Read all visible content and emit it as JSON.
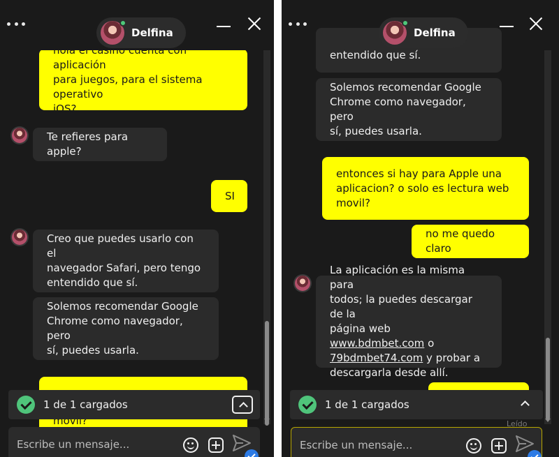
{
  "agent": {
    "name": "Delfina"
  },
  "left": {
    "messages": [
      {
        "from": "user",
        "text": "hola el casino cuenta con aplicación\npara juegos, para el sistema operativo\niOS?"
      },
      {
        "from": "agent",
        "text": "Te refieres para apple?"
      },
      {
        "from": "user",
        "text": "SI"
      },
      {
        "from": "agent",
        "text": "Creo que puedes usarlo con el\nnavegador Safari, pero tengo\nentendido que sí."
      },
      {
        "from": "agent",
        "text": "Solemos recomendar Google\nChrome como navegador, pero\nsí, puedes usarla."
      },
      {
        "from": "user",
        "text": "movil?"
      }
    ]
  },
  "right": {
    "messages": [
      {
        "from": "agent",
        "text": "entendido que sí."
      },
      {
        "from": "agent",
        "text": "Solemos recomendar Google\nChrome como navegador, pero\nsí, puedes usarla."
      },
      {
        "from": "user",
        "text": "entonces si hay para Apple una\naplicacion? o solo es lectura web\nmovil?"
      },
      {
        "from": "user",
        "text": "no me quedo claro"
      },
      {
        "from": "agent",
        "text_before": "La aplicación es la misma para\ntodos; la puedes descargar de la\npágina web ",
        "link1": "www.bdmbet.com",
        "text_mid": " o\n",
        "link2": "79bdmbet74.com",
        "text_after": " y probar a\ndescargarla desde allí."
      }
    ],
    "read_label": "Leído"
  },
  "loaded_label": "1 de 1 cargados",
  "input": {
    "placeholder": "Escribe un mensaje..."
  },
  "colors": {
    "user_bubble": "#ffff00",
    "agent_bubble": "#2b2b2b",
    "background": "#1a1a1a",
    "accent_check": "#4fc47b",
    "send_badge": "#2d7be5"
  },
  "icons": [
    "more-icon",
    "minimize-icon",
    "close-icon",
    "check-icon",
    "chevron-up-icon",
    "emoji-icon",
    "attach-icon",
    "send-icon"
  ]
}
